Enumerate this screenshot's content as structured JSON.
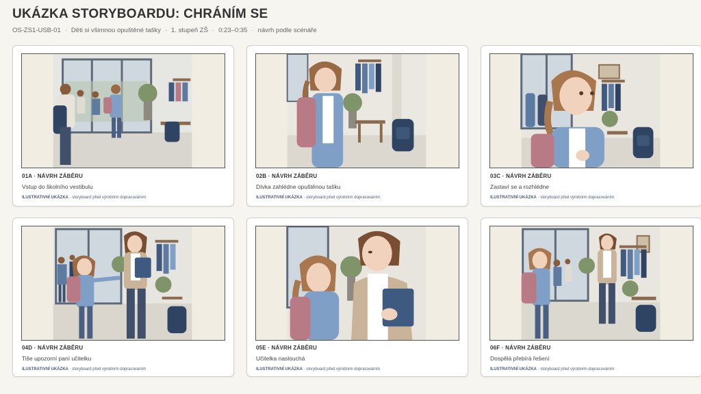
{
  "header": {
    "title": "UKÁZKA STORYBOARDU: CHRÁNÍM SE",
    "meta": [
      "OS-ZS1-USB-01",
      "Děti si všimnou opuštěné tašky",
      "1. stupeň ZŠ",
      "0:23–0:35",
      "návrh podle scénáře"
    ]
  },
  "note": {
    "strong": "ILUSTRATIVNÍ UKÁZKA",
    "rest": " · storyboard před výrobním dopracováním"
  },
  "cards": [
    {
      "label": "01A · NÁVRH ZÁBĚRU",
      "desc": "Vstup do školního vestibulu"
    },
    {
      "label": "02B · NÁVRH ZÁBĚRU",
      "desc": "Dívka zahlédne opuštěnou tašku"
    },
    {
      "label": "03C · NÁVRH ZÁBĚRU",
      "desc": "Zastaví se a rozhlédne"
    },
    {
      "label": "04D · NÁVRH ZÁBĚRU",
      "desc": "Tiše upozorní paní učitelku"
    },
    {
      "label": "05E · NÁVRH ZÁBĚRU",
      "desc": "Učitelka naslouchá"
    },
    {
      "label": "06F · NÁVRH ZÁBĚRU",
      "desc": "Dospělá přebírá řešení"
    }
  ],
  "colors": {
    "background": "#f7f5ef",
    "card_border": "#cfcfcf",
    "note_text": "#4d5d73",
    "backpack": "#2f4463",
    "girl_backpack": "#b87b86",
    "jacket": "#7f9fc7"
  }
}
